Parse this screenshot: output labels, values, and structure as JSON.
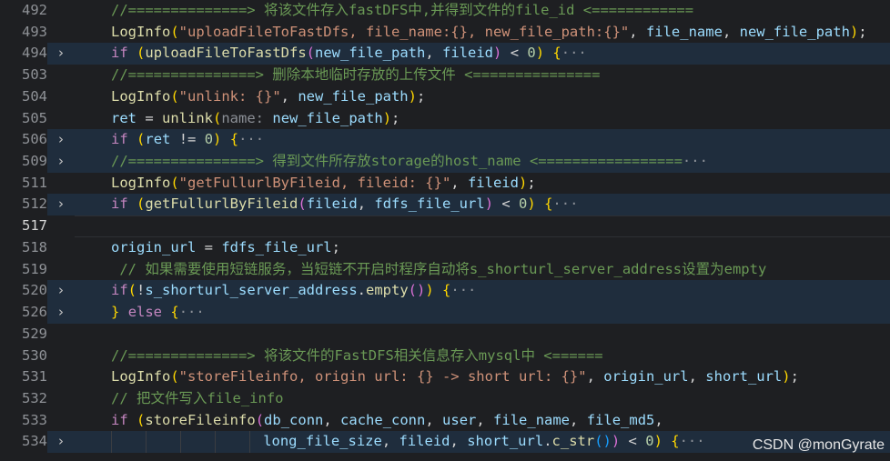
{
  "watermark": "CSDN @monGyrate",
  "lines": [
    {
      "num": "492",
      "fold": false,
      "bg": false,
      "tokens": [
        [
          "c-cm",
          "//==============> 将该文件存入fastDFS中,并得到文件的file_id <============"
        ]
      ]
    },
    {
      "num": "493",
      "fold": false,
      "bg": false,
      "tokens": [
        [
          "c-fn",
          "LogInfo"
        ],
        [
          "c-b1",
          "("
        ],
        [
          "c-str",
          "\"uploadFileToFastDfs, file_name:{}, new_file_path:{}\""
        ],
        [
          "c-op",
          ", "
        ],
        [
          "c-id",
          "file_name"
        ],
        [
          "c-op",
          ", "
        ],
        [
          "c-id",
          "new_file_path"
        ],
        [
          "c-b1",
          ")"
        ],
        [
          "c-op",
          ";"
        ]
      ]
    },
    {
      "num": "494",
      "fold": true,
      "bg": true,
      "tokens": [
        [
          "c-kw",
          "if"
        ],
        [
          "c-op",
          " "
        ],
        [
          "c-b1",
          "("
        ],
        [
          "c-fn",
          "uploadFileToFastDfs"
        ],
        [
          "c-b2",
          "("
        ],
        [
          "c-id",
          "new_file_path"
        ],
        [
          "c-op",
          ", "
        ],
        [
          "c-id",
          "fileid"
        ],
        [
          "c-b2",
          ")"
        ],
        [
          "c-op",
          " < "
        ],
        [
          "c-num",
          "0"
        ],
        [
          "c-b1",
          ")"
        ],
        [
          "c-op",
          " "
        ],
        [
          "c-b1",
          "{"
        ],
        [
          "c-ell",
          "···"
        ]
      ]
    },
    {
      "num": "503",
      "fold": false,
      "bg": false,
      "tokens": [
        [
          "c-cm",
          "//===============> 删除本地临时存放的上传文件 <==============="
        ]
      ]
    },
    {
      "num": "504",
      "fold": false,
      "bg": false,
      "tokens": [
        [
          "c-fn",
          "LogInfo"
        ],
        [
          "c-b1",
          "("
        ],
        [
          "c-str",
          "\"unlink: {}\""
        ],
        [
          "c-op",
          ", "
        ],
        [
          "c-id",
          "new_file_path"
        ],
        [
          "c-b1",
          ")"
        ],
        [
          "c-op",
          ";"
        ]
      ]
    },
    {
      "num": "505",
      "fold": false,
      "bg": false,
      "tokens": [
        [
          "c-id",
          "ret"
        ],
        [
          "c-op",
          " = "
        ],
        [
          "c-fn",
          "unlink"
        ],
        [
          "c-b1",
          "("
        ],
        [
          "c-hint",
          "name:"
        ],
        [
          "c-op",
          " "
        ],
        [
          "c-id",
          "new_file_path"
        ],
        [
          "c-b1",
          ")"
        ],
        [
          "c-op",
          ";"
        ]
      ]
    },
    {
      "num": "506",
      "fold": true,
      "bg": true,
      "tokens": [
        [
          "c-kw",
          "if"
        ],
        [
          "c-op",
          " "
        ],
        [
          "c-b1",
          "("
        ],
        [
          "c-id",
          "ret"
        ],
        [
          "c-op",
          " != "
        ],
        [
          "c-num",
          "0"
        ],
        [
          "c-b1",
          ")"
        ],
        [
          "c-op",
          " "
        ],
        [
          "c-b1",
          "{"
        ],
        [
          "c-ell",
          "···"
        ]
      ]
    },
    {
      "num": "509",
      "fold": true,
      "bg": true,
      "tokens": [
        [
          "c-cm",
          "//===============> 得到文件所存放storage的host_name <================="
        ],
        [
          "c-ell",
          "···"
        ]
      ]
    },
    {
      "num": "511",
      "fold": false,
      "bg": false,
      "tokens": [
        [
          "c-fn",
          "LogInfo"
        ],
        [
          "c-b1",
          "("
        ],
        [
          "c-str",
          "\"getFullurlByFileid, fileid: {}\""
        ],
        [
          "c-op",
          ", "
        ],
        [
          "c-id",
          "fileid"
        ],
        [
          "c-b1",
          ")"
        ],
        [
          "c-op",
          ";"
        ]
      ]
    },
    {
      "num": "512",
      "fold": true,
      "bg": true,
      "tokens": [
        [
          "c-kw",
          "if"
        ],
        [
          "c-op",
          " "
        ],
        [
          "c-b1",
          "("
        ],
        [
          "c-fn",
          "getFullurlByFileid"
        ],
        [
          "c-b2",
          "("
        ],
        [
          "c-id",
          "fileid"
        ],
        [
          "c-op",
          ", "
        ],
        [
          "c-id",
          "fdfs_file_url"
        ],
        [
          "c-b2",
          ")"
        ],
        [
          "c-op",
          " < "
        ],
        [
          "c-num",
          "0"
        ],
        [
          "c-b1",
          ")"
        ],
        [
          "c-op",
          " "
        ],
        [
          "c-b1",
          "{"
        ],
        [
          "c-ell",
          "···"
        ]
      ]
    },
    {
      "num": "517",
      "fold": false,
      "bg": false,
      "current": true,
      "tokens": []
    },
    {
      "num": "518",
      "fold": false,
      "bg": false,
      "tokens": [
        [
          "c-id",
          "origin_url"
        ],
        [
          "c-op",
          " = "
        ],
        [
          "c-id",
          "fdfs_file_url"
        ],
        [
          "c-op",
          ";"
        ]
      ]
    },
    {
      "num": "519",
      "fold": false,
      "bg": false,
      "tokens": [
        [
          "c-op",
          " "
        ],
        [
          "c-cm",
          "// 如果需要使用短链服务，当短链不开启时程序自动将s_shorturl_server_address设置为empty"
        ]
      ]
    },
    {
      "num": "520",
      "fold": true,
      "bg": true,
      "tokens": [
        [
          "c-kw",
          "if"
        ],
        [
          "c-b1",
          "("
        ],
        [
          "c-op",
          "!"
        ],
        [
          "c-id",
          "s_shorturl_server_address"
        ],
        [
          "c-op",
          "."
        ],
        [
          "c-fn",
          "empty"
        ],
        [
          "c-b2",
          "()"
        ],
        [
          "c-b1",
          ")"
        ],
        [
          "c-op",
          " "
        ],
        [
          "c-b1",
          "{"
        ],
        [
          "c-ell",
          "···"
        ]
      ]
    },
    {
      "num": "526",
      "fold": true,
      "bg": true,
      "tokens": [
        [
          "c-b1",
          "}"
        ],
        [
          "c-op",
          " "
        ],
        [
          "c-kw",
          "else"
        ],
        [
          "c-op",
          " "
        ],
        [
          "c-b1",
          "{"
        ],
        [
          "c-ell",
          "···"
        ]
      ]
    },
    {
      "num": "529",
      "fold": false,
      "bg": false,
      "tokens": []
    },
    {
      "num": "530",
      "fold": false,
      "bg": false,
      "tokens": [
        [
          "c-cm",
          "//==============> 将该文件的FastDFS相关信息存入mysql中 <======"
        ]
      ]
    },
    {
      "num": "531",
      "fold": false,
      "bg": false,
      "tokens": [
        [
          "c-fn",
          "LogInfo"
        ],
        [
          "c-b1",
          "("
        ],
        [
          "c-str",
          "\"storeFileinfo, origin url: {} -> short url: {}\""
        ],
        [
          "c-op",
          ", "
        ],
        [
          "c-id",
          "origin_url"
        ],
        [
          "c-op",
          ", "
        ],
        [
          "c-id",
          "short_url"
        ],
        [
          "c-b1",
          ")"
        ],
        [
          "c-op",
          ";"
        ]
      ]
    },
    {
      "num": "532",
      "fold": false,
      "bg": false,
      "tokens": [
        [
          "c-cm",
          "// 把文件写入file_info"
        ]
      ]
    },
    {
      "num": "533",
      "fold": false,
      "bg": false,
      "tokens": [
        [
          "c-kw",
          "if"
        ],
        [
          "c-op",
          " "
        ],
        [
          "c-b1",
          "("
        ],
        [
          "c-fn",
          "storeFileinfo"
        ],
        [
          "c-b2",
          "("
        ],
        [
          "c-id",
          "db_conn"
        ],
        [
          "c-op",
          ", "
        ],
        [
          "c-id",
          "cache_conn"
        ],
        [
          "c-op",
          ", "
        ],
        [
          "c-id",
          "user"
        ],
        [
          "c-op",
          ", "
        ],
        [
          "c-id",
          "file_name"
        ],
        [
          "c-op",
          ", "
        ],
        [
          "c-id",
          "file_md5"
        ],
        [
          "c-op",
          ","
        ]
      ]
    },
    {
      "num": "534",
      "fold": true,
      "bg": true,
      "indent": 22,
      "tokens": [
        [
          "c-id",
          "long_file_size"
        ],
        [
          "c-op",
          ", "
        ],
        [
          "c-id",
          "fileid"
        ],
        [
          "c-op",
          ", "
        ],
        [
          "c-id",
          "short_url"
        ],
        [
          "c-op",
          "."
        ],
        [
          "c-fn",
          "c_str"
        ],
        [
          "c-b3",
          "()"
        ],
        [
          "c-b2",
          ")"
        ],
        [
          "c-op",
          " < "
        ],
        [
          "c-num",
          "0"
        ],
        [
          "c-b1",
          ")"
        ],
        [
          "c-op",
          " "
        ],
        [
          "c-b1",
          "{"
        ],
        [
          "c-ell",
          "···"
        ]
      ]
    }
  ]
}
